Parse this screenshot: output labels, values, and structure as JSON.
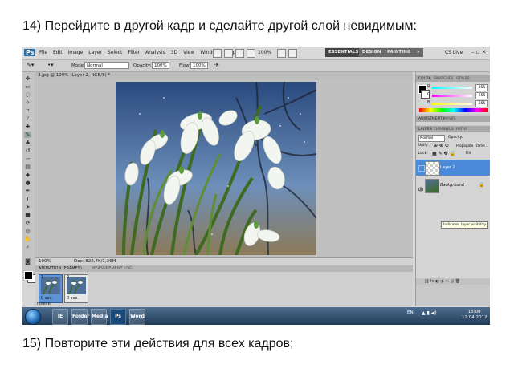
{
  "instructions": {
    "step14": "14) Перейдите в другой кадр и сделайте другой слой невидимым:",
    "step15": "15) Повторите эти действия для всех кадров;"
  },
  "app": {
    "logo": "Ps",
    "menus": [
      "File",
      "Edit",
      "Image",
      "Layer",
      "Select",
      "Filter",
      "Analysis",
      "3D",
      "View",
      "Window",
      "Help"
    ],
    "zoom_value": "100%",
    "workspaces": [
      "ESSENTIALS",
      "DESIGN",
      "PAINTING"
    ],
    "workspace_more": "»",
    "cs_live": "CS Live",
    "window_controls": "– ▫ ✕"
  },
  "options_bar": {
    "mode_label": "Mode:",
    "mode_value": "Normal",
    "opacity_label": "Opacity:",
    "opacity_value": "100%",
    "flow_label": "Flow:",
    "flow_value": "100%"
  },
  "document": {
    "tab_title": "3.jpg @ 100% (Layer 2, RGB/8) *",
    "zoom": "100%",
    "doc_size": "Doc: 822,7K/1,36M"
  },
  "animation_panel": {
    "tabs": [
      "ANIMATION (FRAMES)",
      "MEASUREMENT LOG"
    ],
    "frames": [
      {
        "number": "1",
        "duration": "0 sec."
      },
      {
        "number": "2",
        "duration": "0 sec."
      }
    ],
    "selected_frame": 1,
    "loop": "Forever"
  },
  "panels": {
    "color_tabs": [
      "COLOR",
      "SWATCHES",
      "STYLES"
    ],
    "sliders": [
      {
        "label": "R",
        "value": "255"
      },
      {
        "label": "G",
        "value": "255"
      },
      {
        "label": "B",
        "value": "255"
      }
    ],
    "adjustments_tabs": [
      "ADJUSTMENTS",
      "MASKS"
    ],
    "layers_tabs": [
      "LAYERS",
      "CHANNELS",
      "PATHS"
    ],
    "blend_mode": "Normal",
    "opacity_label": "Opacity:",
    "unify_label": "Unify:",
    "propagate_label": "Propagate Frame 1",
    "lock_label": "Lock:",
    "fill_label": "Fill:",
    "layers": [
      {
        "name": "Layer 2",
        "visible": false,
        "selected": true
      },
      {
        "name": "Background",
        "visible": true,
        "selected": false
      }
    ],
    "tooltip": "Indicates layer visibility"
  },
  "taskbar": {
    "apps": [
      "IE",
      "Folder",
      "Media",
      "Ps",
      "Word"
    ],
    "language": "EN",
    "time": "15:08",
    "date": "12.04.2012"
  },
  "colors": {
    "selection_blue": "#4a8ad8",
    "workspace_dark": "#444444",
    "taskbar": "#213b57"
  }
}
